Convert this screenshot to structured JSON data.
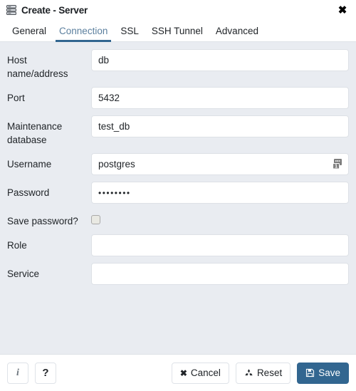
{
  "window": {
    "title": "Create - Server",
    "title_icon": "server-rack-icon",
    "close_icon": "close-icon",
    "close_label": "✖"
  },
  "tabs": [
    {
      "label": "General",
      "active": false
    },
    {
      "label": "Connection",
      "active": true
    },
    {
      "label": "SSL",
      "active": false
    },
    {
      "label": "SSH Tunnel",
      "active": false
    },
    {
      "label": "Advanced",
      "active": false
    }
  ],
  "form": {
    "host": {
      "label": "Host name/address",
      "value": "db",
      "placeholder": ""
    },
    "port": {
      "label": "Port",
      "value": "5432",
      "placeholder": ""
    },
    "maintenance_db": {
      "label": "Maintenance database",
      "value": "test_db",
      "placeholder": ""
    },
    "username": {
      "label": "Username",
      "value": "postgres",
      "placeholder": "",
      "autofill_icon": "saved-logins-icon",
      "autofill_count": "1"
    },
    "password": {
      "label": "Password",
      "value": "••••••••",
      "placeholder": ""
    },
    "save_password": {
      "label": "Save password?",
      "checked": false
    },
    "role": {
      "label": "Role",
      "value": "",
      "placeholder": ""
    },
    "service": {
      "label": "Service",
      "value": "",
      "placeholder": ""
    }
  },
  "footer": {
    "info_label": "i",
    "info_icon": "info-icon",
    "help_label": "?",
    "help_icon": "help-icon",
    "cancel": {
      "label": "Cancel",
      "icon": "cross-icon",
      "glyph": "✖"
    },
    "reset": {
      "label": "Reset",
      "icon": "recycle-icon",
      "glyph": "♻"
    },
    "save": {
      "label": "Save",
      "icon": "floppy-disk-icon",
      "glyph": "💾"
    }
  },
  "colors": {
    "accent": "#326690",
    "body_background": "#e9ecf1",
    "panel_background": "#ffffff",
    "border": "#dfe3e8",
    "active_tab_text": "#5b7f9e"
  }
}
